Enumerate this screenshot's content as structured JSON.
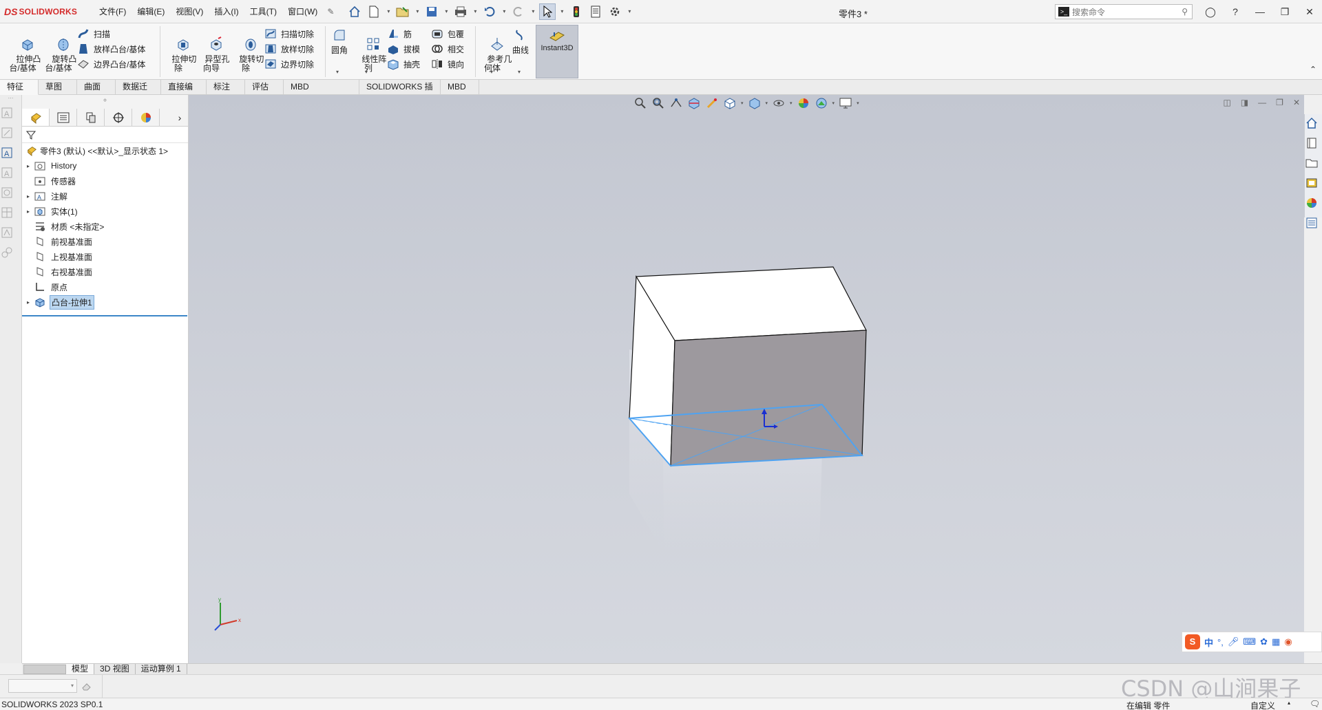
{
  "app": {
    "logo_prefix": "DS",
    "logo_text": "SOLIDWORKS",
    "doc_title": "零件3 *",
    "search_placeholder": "搜索命令",
    "menus": [
      "文件(F)",
      "编辑(E)",
      "视图(V)",
      "插入(I)",
      "工具(T)",
      "窗口(W)"
    ]
  },
  "ribbon": {
    "extrude_boss": "拉伸凸\n台/基体",
    "revolve_boss": "旋转凸\n台/基体",
    "sweep": "扫描",
    "loft": "放样凸台/基体",
    "boundary_boss": "边界凸台/基体",
    "extrude_cut": "拉伸切\n除",
    "hole_wizard": "异型孔\n向导",
    "revolve_cut": "旋转切\n除",
    "sweep_cut": "扫描切除",
    "loft_cut": "放样切除",
    "boundary_cut": "边界切除",
    "fillet": "圆角",
    "linear_pattern": "线性阵\n列",
    "rib": "筋",
    "draft": "拔模",
    "shell": "抽壳",
    "wrap": "包覆",
    "intersect": "相交",
    "mirror": "镜向",
    "ref_geometry": "参考几\n何体",
    "curves": "曲线",
    "instant3d": "Instant3D"
  },
  "tabs": [
    "特征",
    "草图",
    "曲面",
    "数据迁移",
    "直接编辑",
    "标注",
    "评估",
    "MBD Dimensions",
    "SOLIDWORKS 插件",
    "MBD"
  ],
  "feature_tree": {
    "root": "零件3 (默认) <<默认>_显示状态 1>",
    "items": [
      {
        "label": "History",
        "expandable": true
      },
      {
        "label": "传感器",
        "expandable": false
      },
      {
        "label": "注解",
        "expandable": true
      },
      {
        "label": "实体(1)",
        "expandable": true
      },
      {
        "label": "材质 <未指定>",
        "expandable": false
      },
      {
        "label": "前视基准面",
        "expandable": false
      },
      {
        "label": "上视基准面",
        "expandable": false
      },
      {
        "label": "右视基准面",
        "expandable": false
      },
      {
        "label": "原点",
        "expandable": false
      },
      {
        "label": "凸台-拉伸1",
        "expandable": true,
        "selected": true
      }
    ]
  },
  "bottom_tabs": [
    "模型",
    "3D 视图",
    "运动算例 1"
  ],
  "status": {
    "version": "SOLIDWORKS 2023 SP0.1",
    "editing": "在编辑 零件",
    "customize": "自定义"
  },
  "ime": {
    "logo": "S",
    "lang": "中",
    "punct": "°,"
  },
  "watermark": "CSDN @山涧果子",
  "triad": {
    "x_label": "x",
    "y_label": "y"
  },
  "colors": {
    "accent": "#3b86c8",
    "viewport_bg": "#c8ccd5",
    "selection_edge": "#4ea3f2",
    "logo_red": "#d42b2b"
  }
}
